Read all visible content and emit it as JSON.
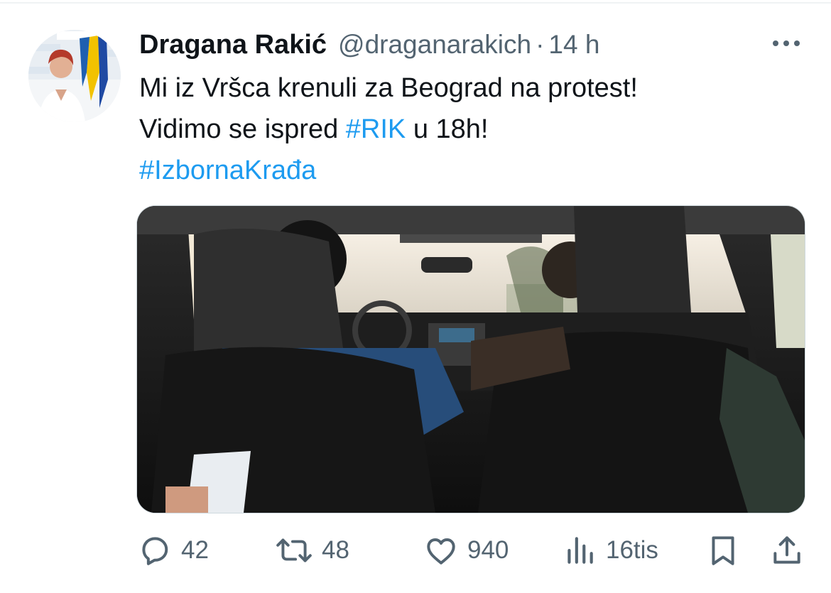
{
  "tweet": {
    "author": {
      "display_name": "Dragana Rakić",
      "handle": "@draganarakich",
      "separator": "·",
      "time": "14 h"
    },
    "text": {
      "line1": "Mi iz Vršca krenuli za Beograd na protest!",
      "line2_prefix": "Vidimo se ispred ",
      "line2_hashtag": "#RIK",
      "line2_suffix": " u 18h!",
      "line3_hashtag": "#IzbornaKrađa"
    },
    "media": {
      "icon": "photo-car-interior"
    },
    "actions": {
      "replies": "42",
      "reposts": "48",
      "likes": "940",
      "views": "16tis"
    }
  },
  "icons": {
    "more": "more-horizontal-icon",
    "reply": "reply-bubble-icon",
    "repost": "repost-arrows-icon",
    "like": "heart-icon",
    "views": "bar-chart-icon",
    "bookmark": "bookmark-icon",
    "share": "share-upload-icon"
  },
  "colors": {
    "link": "#1d9bf0",
    "secondary_text": "#536471",
    "primary_text": "#0f1419"
  }
}
